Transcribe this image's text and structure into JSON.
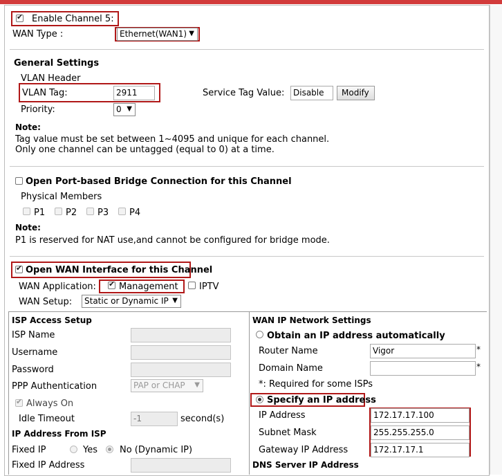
{
  "channel": {
    "enable_label": "Enable Channel 5:",
    "enabled": true
  },
  "wan_type": {
    "label": "WAN Type  :",
    "value": "Ethernet(WAN1)"
  },
  "general": {
    "heading": "General Settings",
    "vlan_header": "VLAN Header",
    "vlan_tag_label": "VLAN Tag:",
    "vlan_tag_value": "2911",
    "service_tag_label": "Service Tag Value:",
    "service_tag_value": "Disable",
    "modify_label": "Modify",
    "priority_label": "Priority:",
    "priority_value": "0",
    "note_heading": "Note:",
    "note_line1": "Tag value must be set between 1~4095 and unique for each channel.",
    "note_line2": "Only one channel can be untagged (equal to 0) at a time."
  },
  "bridge": {
    "label": "Open Port-based Bridge Connection for this Channel",
    "physical_members": "Physical Members",
    "ports": [
      "P1",
      "P2",
      "P3",
      "P4"
    ],
    "note_heading": "Note:",
    "note_line": "P1 is reserved for NAT use,and cannot be configured for bridge mode."
  },
  "wan_interface": {
    "label": "Open WAN Interface for this Channel",
    "app_label": "WAN Application:",
    "management": "Management",
    "iptv": "IPTV",
    "setup_label": "WAN Setup:",
    "setup_value": "Static or Dynamic IP"
  },
  "isp": {
    "heading": "ISP Access Setup",
    "isp_name": "ISP Name",
    "username": "Username",
    "password": "Password",
    "ppp_auth_label": "PPP Authentication",
    "ppp_auth_value": "PAP or CHAP",
    "always_on": "Always On",
    "idle_timeout": "Idle Timeout",
    "idle_value": "-1",
    "idle_unit": "second(s)",
    "ip_from_isp": "IP Address From ISP",
    "fixed_ip": "Fixed IP",
    "yes": "Yes",
    "no": "No (Dynamic IP)",
    "fixed_ip_address": "Fixed IP Address"
  },
  "wan_ip": {
    "heading": "WAN IP Network Settings",
    "obtain_auto": "Obtain an IP address automatically",
    "router_name_label": "Router Name",
    "router_name_value": "Vigor",
    "domain_name_label": "Domain Name",
    "required_note": "*: Required for some ISPs",
    "star": "*",
    "specify": "Specify an IP address",
    "ip_address_label": "IP Address",
    "ip_address_value": "172.17.17.100",
    "subnet_label": "Subnet Mask",
    "subnet_value": "255.255.255.0",
    "gateway_label": "Gateway IP Address",
    "gateway_value": "172.17.17.1",
    "dns_heading": "DNS Server IP Address"
  },
  "colors": {
    "highlight_red": "#b01717",
    "top_bar": "#d23b3b"
  }
}
